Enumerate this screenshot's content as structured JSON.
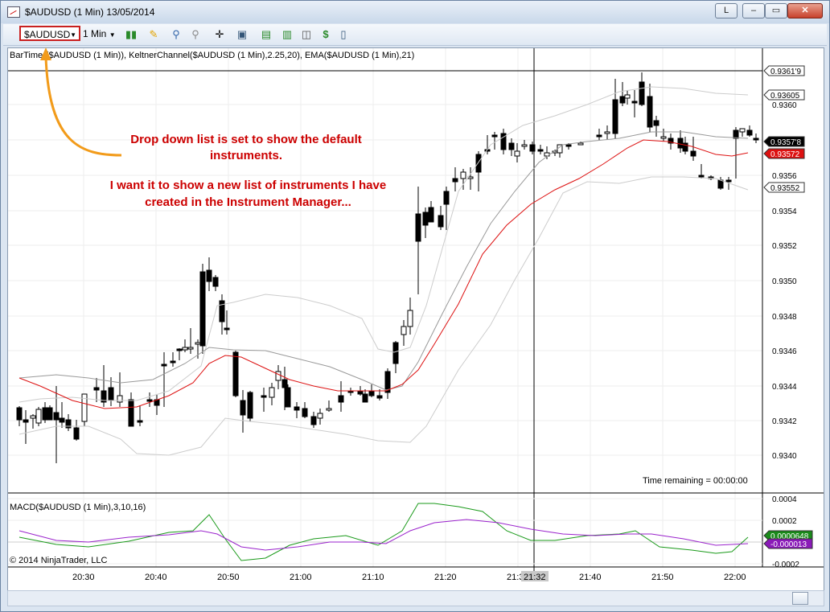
{
  "window": {
    "title": "$AUDUSD (1 Min)  13/05/2014",
    "buttons": [
      "L",
      "–",
      "▭",
      "✕"
    ]
  },
  "toolbar": {
    "instrument": "$AUDUSD",
    "period": "1 Min"
  },
  "chart": {
    "indicator_label": "BarTimer($AUDUSD (1 Min)), KeltnerChannel($AUDUSD (1 Min),2.25,20), EMA($AUDUSD (1 Min),21)",
    "macd_label": "MACD($AUDUSD (1 Min),3,10,16)",
    "copyright": "© 2014 NinjaTrader, LLC",
    "time_remaining": "Time remaining = 00:00:00",
    "crosshair_time": "21:32",
    "price_axis": [
      "0.9360",
      "0.9358",
      "0.9356",
      "0.9354",
      "0.9352",
      "0.9350",
      "0.9348",
      "0.9346",
      "0.9344",
      "0.9342",
      "0.9340"
    ],
    "price_tags": [
      {
        "label": "0.9361'9",
        "fill": "#ffffff",
        "color": "#000000"
      },
      {
        "label": "0.93605",
        "fill": "#ffffff",
        "color": "#000000"
      },
      {
        "label": "0.9357'8",
        "fill": "#000000",
        "color": "#ffffff"
      },
      {
        "label": "0.93572",
        "fill": "#dd1111",
        "color": "#ffffff"
      },
      {
        "label": "0.93552",
        "fill": "#ffffff",
        "color": "#000000"
      }
    ],
    "macd_axis": [
      "0.0004",
      "0.0002",
      "0",
      "-0.0002"
    ],
    "macd_tags": [
      {
        "label": "0.0000648",
        "fill": "#1a8a1a",
        "color": "#ffffff"
      },
      {
        "label": "-0.000013",
        "fill": "#8a1ab8",
        "color": "#ffffff"
      }
    ],
    "time_axis": [
      "20:30",
      "20:40",
      "20:50",
      "21:00",
      "21:10",
      "21:20",
      "21:30",
      "21:40",
      "21:50",
      "22:00"
    ],
    "colors": {
      "ema": "#dd1111",
      "keltner_mid": "#999999",
      "keltner_band": "#cccccc",
      "macd": "#1a9a1a",
      "signal": "#9a22cc",
      "annotation": "#cc0000",
      "arrow": "#f29b1a"
    }
  },
  "annotation": {
    "line1": "Drop down list is set to show the default",
    "line2": "instruments.",
    "line3": "I want it to show a new list of instruments I have",
    "line4": "created in the Instrument Manager..."
  }
}
